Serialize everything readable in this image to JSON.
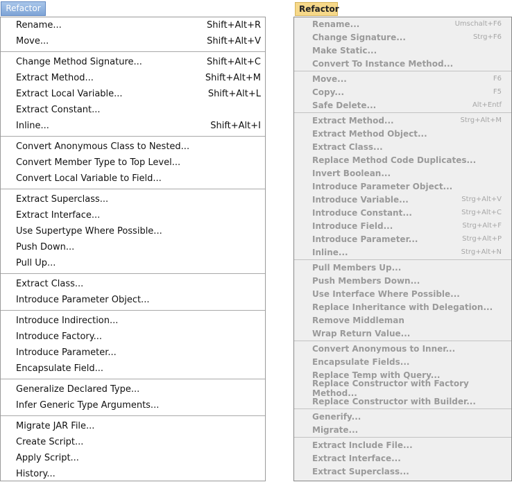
{
  "left_menu": {
    "title": "Refactor",
    "groups": [
      [
        {
          "label": "Rename...",
          "shortcut": "Shift+Alt+R"
        },
        {
          "label": "Move...",
          "shortcut": "Shift+Alt+V"
        }
      ],
      [
        {
          "label": "Change Method Signature...",
          "shortcut": "Shift+Alt+C"
        },
        {
          "label": "Extract Method...",
          "shortcut": "Shift+Alt+M"
        },
        {
          "label": "Extract Local Variable...",
          "shortcut": "Shift+Alt+L"
        },
        {
          "label": "Extract Constant...",
          "shortcut": ""
        },
        {
          "label": "Inline...",
          "shortcut": "Shift+Alt+I"
        }
      ],
      [
        {
          "label": "Convert Anonymous Class to Nested...",
          "shortcut": ""
        },
        {
          "label": "Convert Member Type to Top Level...",
          "shortcut": ""
        },
        {
          "label": "Convert Local Variable to Field...",
          "shortcut": ""
        }
      ],
      [
        {
          "label": "Extract Superclass...",
          "shortcut": ""
        },
        {
          "label": "Extract Interface...",
          "shortcut": ""
        },
        {
          "label": "Use Supertype Where Possible...",
          "shortcut": ""
        },
        {
          "label": "Push Down...",
          "shortcut": ""
        },
        {
          "label": "Pull Up...",
          "shortcut": ""
        }
      ],
      [
        {
          "label": "Extract Class...",
          "shortcut": ""
        },
        {
          "label": "Introduce Parameter Object...",
          "shortcut": ""
        }
      ],
      [
        {
          "label": "Introduce Indirection...",
          "shortcut": ""
        },
        {
          "label": "Introduce Factory...",
          "shortcut": ""
        },
        {
          "label": "Introduce Parameter...",
          "shortcut": ""
        },
        {
          "label": "Encapsulate Field...",
          "shortcut": ""
        }
      ],
      [
        {
          "label": "Generalize Declared Type...",
          "shortcut": ""
        },
        {
          "label": "Infer Generic Type Arguments...",
          "shortcut": ""
        }
      ],
      [
        {
          "label": "Migrate JAR File...",
          "shortcut": ""
        },
        {
          "label": "Create Script...",
          "shortcut": ""
        },
        {
          "label": "Apply Script...",
          "shortcut": ""
        },
        {
          "label": "History...",
          "shortcut": ""
        }
      ]
    ]
  },
  "right_menu": {
    "title": "Refactor",
    "groups": [
      [
        {
          "label": "Rename...",
          "shortcut": "Umschalt+F6"
        },
        {
          "label": "Change Signature...",
          "shortcut": "Strg+F6"
        },
        {
          "label": "Make Static...",
          "shortcut": ""
        },
        {
          "label": "Convert To Instance Method...",
          "shortcut": ""
        }
      ],
      [
        {
          "label": "Move...",
          "shortcut": "F6"
        },
        {
          "label": "Copy...",
          "shortcut": "F5"
        },
        {
          "label": "Safe Delete...",
          "shortcut": "Alt+Entf"
        }
      ],
      [
        {
          "label": "Extract Method...",
          "shortcut": "Strg+Alt+M"
        },
        {
          "label": "Extract Method Object...",
          "shortcut": ""
        },
        {
          "label": "Extract Class...",
          "shortcut": ""
        },
        {
          "label": "Replace Method Code Duplicates...",
          "shortcut": ""
        },
        {
          "label": "Invert Boolean...",
          "shortcut": ""
        },
        {
          "label": "Introduce Parameter Object...",
          "shortcut": ""
        },
        {
          "label": "Introduce Variable...",
          "shortcut": "Strg+Alt+V"
        },
        {
          "label": "Introduce Constant...",
          "shortcut": "Strg+Alt+C"
        },
        {
          "label": "Introduce Field...",
          "shortcut": "Strg+Alt+F"
        },
        {
          "label": "Introduce Parameter...",
          "shortcut": "Strg+Alt+P"
        },
        {
          "label": "Inline...",
          "shortcut": "Strg+Alt+N"
        }
      ],
      [
        {
          "label": "Pull Members Up...",
          "shortcut": ""
        },
        {
          "label": "Push Members Down...",
          "shortcut": ""
        },
        {
          "label": "Use Interface Where Possible...",
          "shortcut": ""
        },
        {
          "label": "Replace Inheritance with Delegation...",
          "shortcut": ""
        },
        {
          "label": "Remove Middleman",
          "shortcut": ""
        },
        {
          "label": "Wrap Return Value...",
          "shortcut": ""
        }
      ],
      [
        {
          "label": "Convert Anonymous to Inner...",
          "shortcut": ""
        },
        {
          "label": "Encapsulate Fields...",
          "shortcut": ""
        },
        {
          "label": "Replace Temp with Query...",
          "shortcut": ""
        },
        {
          "label": "Replace Constructor with Factory Method...",
          "shortcut": ""
        },
        {
          "label": "Replace Constructor with Builder...",
          "shortcut": ""
        }
      ],
      [
        {
          "label": "Generify...",
          "shortcut": ""
        },
        {
          "label": "Migrate...",
          "shortcut": ""
        }
      ],
      [
        {
          "label": "Extract Include File...",
          "shortcut": ""
        },
        {
          "label": "Extract Interface...",
          "shortcut": ""
        },
        {
          "label": "Extract Superclass...",
          "shortcut": ""
        }
      ]
    ]
  }
}
